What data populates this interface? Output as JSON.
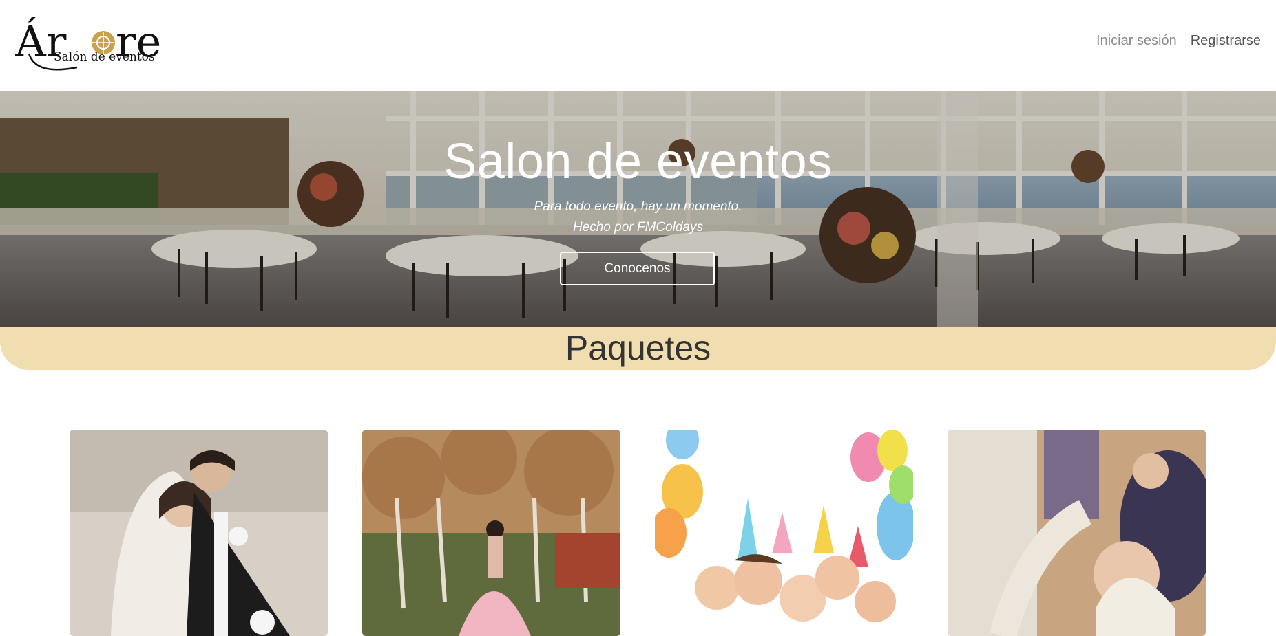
{
  "navbar": {
    "logo_title": "Árbore",
    "logo_subtitle": "Salón de eventos",
    "login_label": "Iniciar sesión",
    "register_label": "Registrarse"
  },
  "hero": {
    "title": "Salon de eventos",
    "subtitle_line1": "Para todo evento, hay un momento.",
    "subtitle_line2": "Hecho por FMColdays",
    "button_label": "Conocenos"
  },
  "packages": {
    "title": "Paquetes",
    "cards": [
      {
        "image": "wedding-couple-photo"
      },
      {
        "image": "quinceanera-dress-photo"
      },
      {
        "image": "kids-birthday-party-photo"
      },
      {
        "image": "baptism-baby-photo"
      }
    ]
  },
  "colors": {
    "band": "#f0ddb0",
    "logo_accent": "#c9a04c"
  }
}
